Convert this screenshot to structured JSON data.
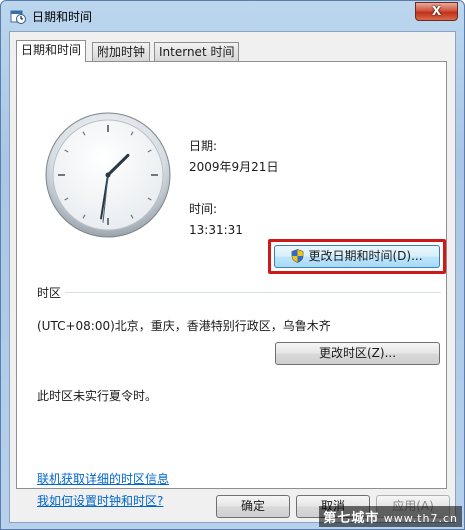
{
  "window": {
    "title": "日期和时间",
    "close_label": "X"
  },
  "tabs": [
    {
      "label": "日期和时间",
      "active": true
    },
    {
      "label": "附加时钟",
      "active": false
    },
    {
      "label": "Internet 时间",
      "active": false
    }
  ],
  "clock": {
    "hour": 13,
    "minute": 31,
    "second": 31
  },
  "datetime": {
    "date_label": "日期:",
    "date_value": "2009年9月21日",
    "time_label": "时间:",
    "time_value": "13:31:31",
    "change_button": "更改日期和时间(D)..."
  },
  "timezone": {
    "header": "时区",
    "value": "(UTC+08:00)北京，重庆，香港特别行政区，乌鲁木齐",
    "change_button": "更改时区(Z)...",
    "dst_note": "此时区未实行夏令时。"
  },
  "links": {
    "online_info": "联机获取详细的时区信息",
    "how_to": "我如何设置时钟和时区?"
  },
  "footer": {
    "ok": "确定",
    "cancel": "取消",
    "apply": "应用(A)"
  },
  "watermark": {
    "brand": "第七城市",
    "site": "www.th7.cn"
  },
  "colors": {
    "highlight": "#d11818",
    "link": "#0066cc"
  }
}
